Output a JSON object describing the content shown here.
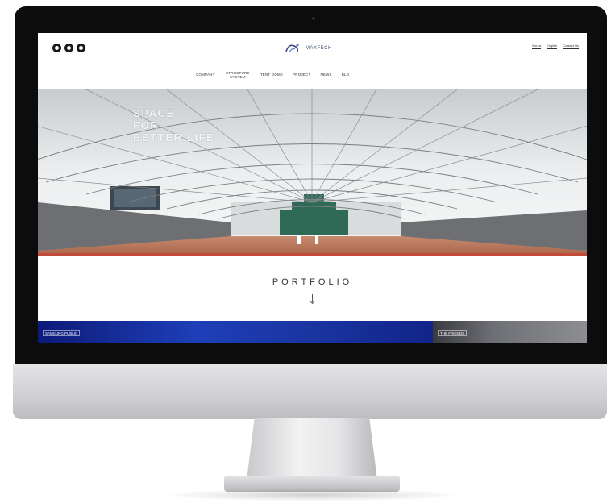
{
  "site": {
    "logo_text": "MAXFECH",
    "social": [
      "social-icon-1",
      "social-icon-2",
      "social-icon-3"
    ],
    "utility_links": [
      "Korea",
      "English",
      "Contact Us"
    ],
    "nav": [
      "COMPANY",
      "STRUCTURE SYSTEM",
      "TENT DOME",
      "PROJECT",
      "NEWS",
      "BLO"
    ],
    "hero_tagline": "SPACE\nFOR\nBETTER LIFE",
    "portfolio_heading": "PORTFOLIO",
    "strip_left_label": "SAMSUNG PUBLIC",
    "strip_right_label": "THE FRIENDS"
  },
  "colors": {
    "bezel": "#0c0c0d",
    "logo": "#3a4a78",
    "strip_blue": "#1e3fb8",
    "floor": "#b9745a"
  }
}
